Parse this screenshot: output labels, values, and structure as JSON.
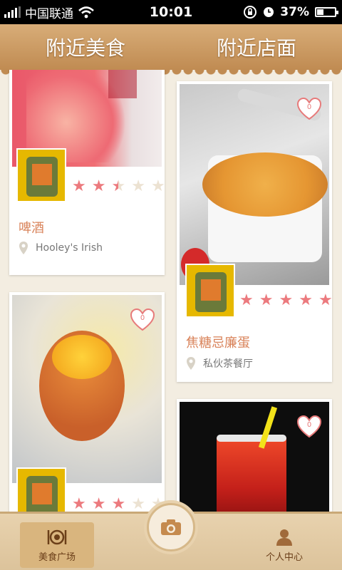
{
  "status_bar": {
    "carrier": "中国联通",
    "time": "10:01",
    "battery": "37%"
  },
  "tabs": [
    {
      "label": "附近美食"
    },
    {
      "label": "附近店面"
    }
  ],
  "cards": [
    {
      "dish": "啤酒",
      "place": "Hooley's Irish",
      "rating": 2.5,
      "likes": null
    },
    {
      "dish": "焦糖忌廉蛋",
      "place": "私伙茶餐厅",
      "rating": 5,
      "likes": "0"
    },
    {
      "dish": "",
      "place": "",
      "rating": 3,
      "likes": "0"
    },
    {
      "dish": "",
      "place": "",
      "rating": null,
      "likes": "0"
    }
  ],
  "bottom_nav": [
    {
      "label": "美食广场"
    },
    {
      "label": "个人中心"
    }
  ],
  "colors": {
    "accent": "#d9835a",
    "star_on": "#ec7a7e",
    "header": "#c08b52"
  }
}
